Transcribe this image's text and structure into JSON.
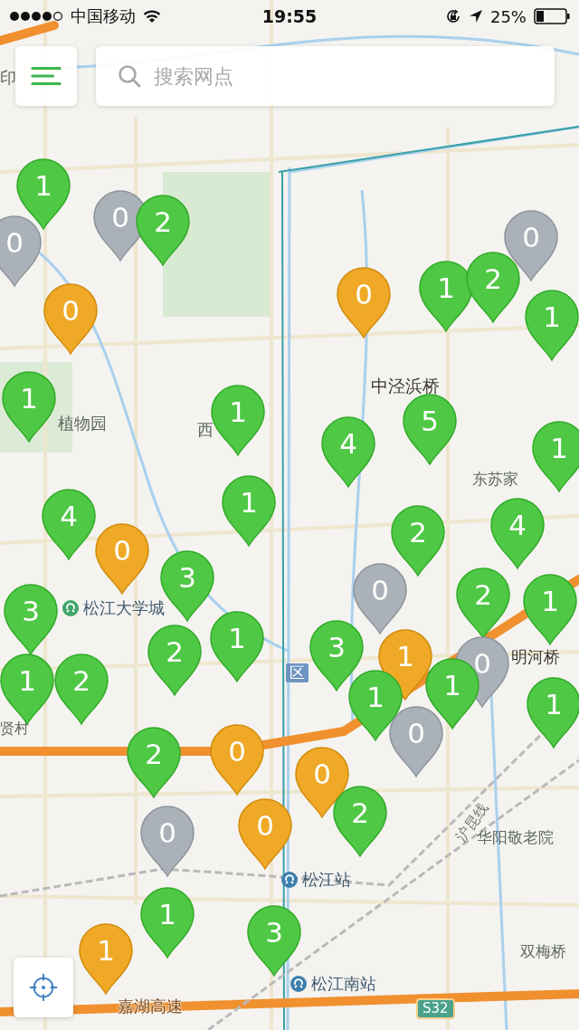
{
  "status_bar": {
    "carrier": "中国移动",
    "time": "19:55",
    "battery": "25%"
  },
  "search": {
    "placeholder": "搜索网点"
  },
  "map_labels": [
    {
      "kind": "place",
      "text": "印"
    },
    {
      "kind": "place",
      "text": "植物园"
    },
    {
      "kind": "place",
      "text": "西"
    },
    {
      "kind": "place",
      "text": "中泾浜桥"
    },
    {
      "kind": "place",
      "text": "东苏家"
    },
    {
      "kind": "station",
      "text": "松江大学城"
    },
    {
      "kind": "place",
      "text": "明河桥"
    },
    {
      "kind": "district",
      "text": "区"
    },
    {
      "kind": "place",
      "text": "贤村"
    },
    {
      "kind": "railway",
      "text": "沪昆线"
    },
    {
      "kind": "place",
      "text": "华阳敬老院"
    },
    {
      "kind": "station",
      "text": "松江站"
    },
    {
      "kind": "place",
      "text": "双梅桥"
    },
    {
      "kind": "station",
      "text": "松江南站"
    },
    {
      "kind": "road",
      "text": "嘉湖高速"
    },
    {
      "kind": "shield",
      "text": "S32"
    }
  ],
  "pins": [
    {
      "count": "1",
      "color": "#4fc845"
    },
    {
      "count": "0",
      "color": "#aab1b8"
    },
    {
      "count": "2",
      "color": "#4fc845"
    },
    {
      "count": "0",
      "color": "#aab1b8"
    },
    {
      "count": "0",
      "color": "#efa927"
    },
    {
      "count": "0",
      "color": "#efa927"
    },
    {
      "count": "1",
      "color": "#4fc845"
    },
    {
      "count": "0",
      "color": "#aab1b8"
    },
    {
      "count": "2",
      "color": "#4fc845"
    },
    {
      "count": "1",
      "color": "#4fc845"
    },
    {
      "count": "1",
      "color": "#4fc845"
    },
    {
      "count": "1",
      "color": "#4fc845"
    },
    {
      "count": "4",
      "color": "#4fc845"
    },
    {
      "count": "5",
      "color": "#4fc845"
    },
    {
      "count": "1",
      "color": "#4fc845"
    },
    {
      "count": "1",
      "color": "#4fc845"
    },
    {
      "count": "4",
      "color": "#4fc845"
    },
    {
      "count": "0",
      "color": "#efa927"
    },
    {
      "count": "2",
      "color": "#4fc845"
    },
    {
      "count": "4",
      "color": "#4fc845"
    },
    {
      "count": "3",
      "color": "#4fc845"
    },
    {
      "count": "0",
      "color": "#aab1b8"
    },
    {
      "count": "2",
      "color": "#4fc845"
    },
    {
      "count": "1",
      "color": "#4fc845"
    },
    {
      "count": "3",
      "color": "#4fc845"
    },
    {
      "count": "2",
      "color": "#4fc845"
    },
    {
      "count": "1",
      "color": "#4fc845"
    },
    {
      "count": "3",
      "color": "#4fc845"
    },
    {
      "count": "1",
      "color": "#efa927"
    },
    {
      "count": "1",
      "color": "#4fc845"
    },
    {
      "count": "2",
      "color": "#4fc845"
    },
    {
      "count": "0",
      "color": "#aab1b8"
    },
    {
      "count": "1",
      "color": "#4fc845"
    },
    {
      "count": "1",
      "color": "#4fc845"
    },
    {
      "count": "1",
      "color": "#4fc845"
    },
    {
      "count": "0",
      "color": "#aab1b8"
    },
    {
      "count": "0",
      "color": "#efa927"
    },
    {
      "count": "2",
      "color": "#4fc845"
    },
    {
      "count": "0",
      "color": "#aab1b8"
    },
    {
      "count": "0",
      "color": "#efa927"
    },
    {
      "count": "2",
      "color": "#4fc845"
    },
    {
      "count": "0",
      "color": "#efa927"
    },
    {
      "count": "1",
      "color": "#4fc845"
    },
    {
      "count": "1",
      "color": "#efa927"
    },
    {
      "count": "3",
      "color": "#4fc845"
    }
  ]
}
